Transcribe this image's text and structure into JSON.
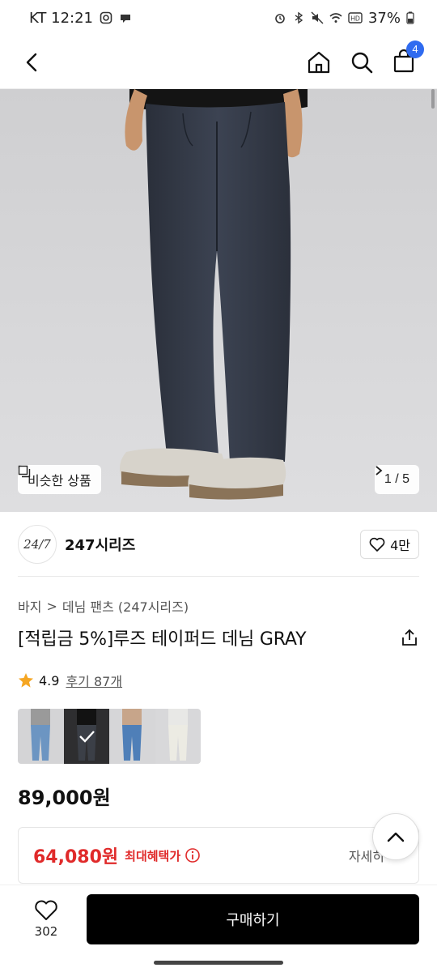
{
  "status": {
    "left": "KT 12:21",
    "battery": "37%"
  },
  "nav": {
    "cart_count": "4"
  },
  "hero": {
    "similar_label": "비슷한 상품",
    "pager": "1 / 5"
  },
  "brand": {
    "logo_text": "24/7",
    "name": "247시리즈",
    "likes": "4만"
  },
  "breadcrumb": {
    "cat1": "바지",
    "sep": ">",
    "cat2": "데님 팬츠 (247시리즈)"
  },
  "product": {
    "title": "[적립금 5%]루즈 테이퍼드 데님 GRAY",
    "rating": "4.9",
    "reviews": "후기 87개",
    "price": "89,000원"
  },
  "benefit": {
    "price": "64,080원",
    "label": "최대혜택가",
    "detail": "자세히"
  },
  "bottom": {
    "wish_count": "302",
    "buy_label": "구매하기"
  },
  "colors": {
    "accent_blue": "#2f6bf0",
    "sale_red": "#e02a2a",
    "star": "#f5a623"
  }
}
